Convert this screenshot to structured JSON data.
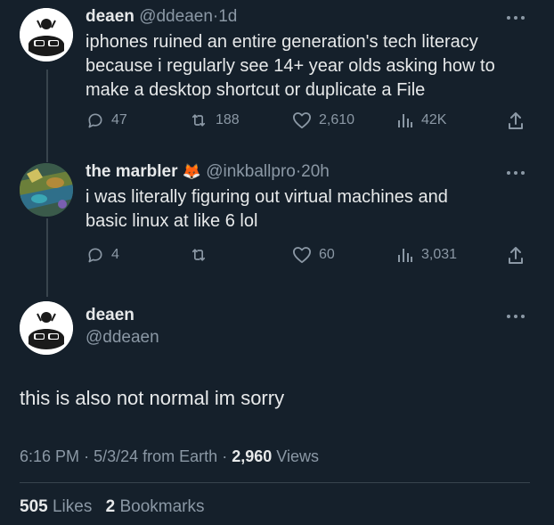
{
  "tweet1": {
    "name": "deaen",
    "handle": "@ddeaen",
    "sep": "·",
    "time": "1d",
    "text_lines": [
      "iphones ruined an entire generation's tech literacy",
      "because i regularly see 14+ year olds asking how to",
      "make a desktop shortcut or duplicate a File"
    ],
    "replies": "47",
    "retweets": "188",
    "likes": "2,610",
    "views": "42K"
  },
  "tweet2": {
    "name": "the marbler",
    "emoji": "🦊",
    "handle": "@inkballpro",
    "sep": "·",
    "time": "20h",
    "text_lines": [
      "i was literally figuring out virtual machines and",
      "basic linux at like 6 lol"
    ],
    "replies": "4",
    "likes": "60",
    "views": "3,031"
  },
  "main": {
    "name": "deaen",
    "handle": "@ddeaen",
    "text": "this is also not normal im sorry",
    "time": "6:16 PM",
    "date": "5/3/24",
    "source": "from Earth",
    "views_count": "2,960",
    "views_label": "Views",
    "likes_count": "505",
    "likes_label": "Likes",
    "bookmarks_count": "2",
    "bookmarks_label": "Bookmarks",
    "dot": "·"
  },
  "icons": [
    "more-icon",
    "reply-icon",
    "retweet-icon",
    "like-icon",
    "views-icon",
    "share-icon"
  ],
  "colors": {
    "background": "#15202b",
    "text": "#e7e9ea",
    "muted": "#8b98a5",
    "divider": "#38444d"
  }
}
